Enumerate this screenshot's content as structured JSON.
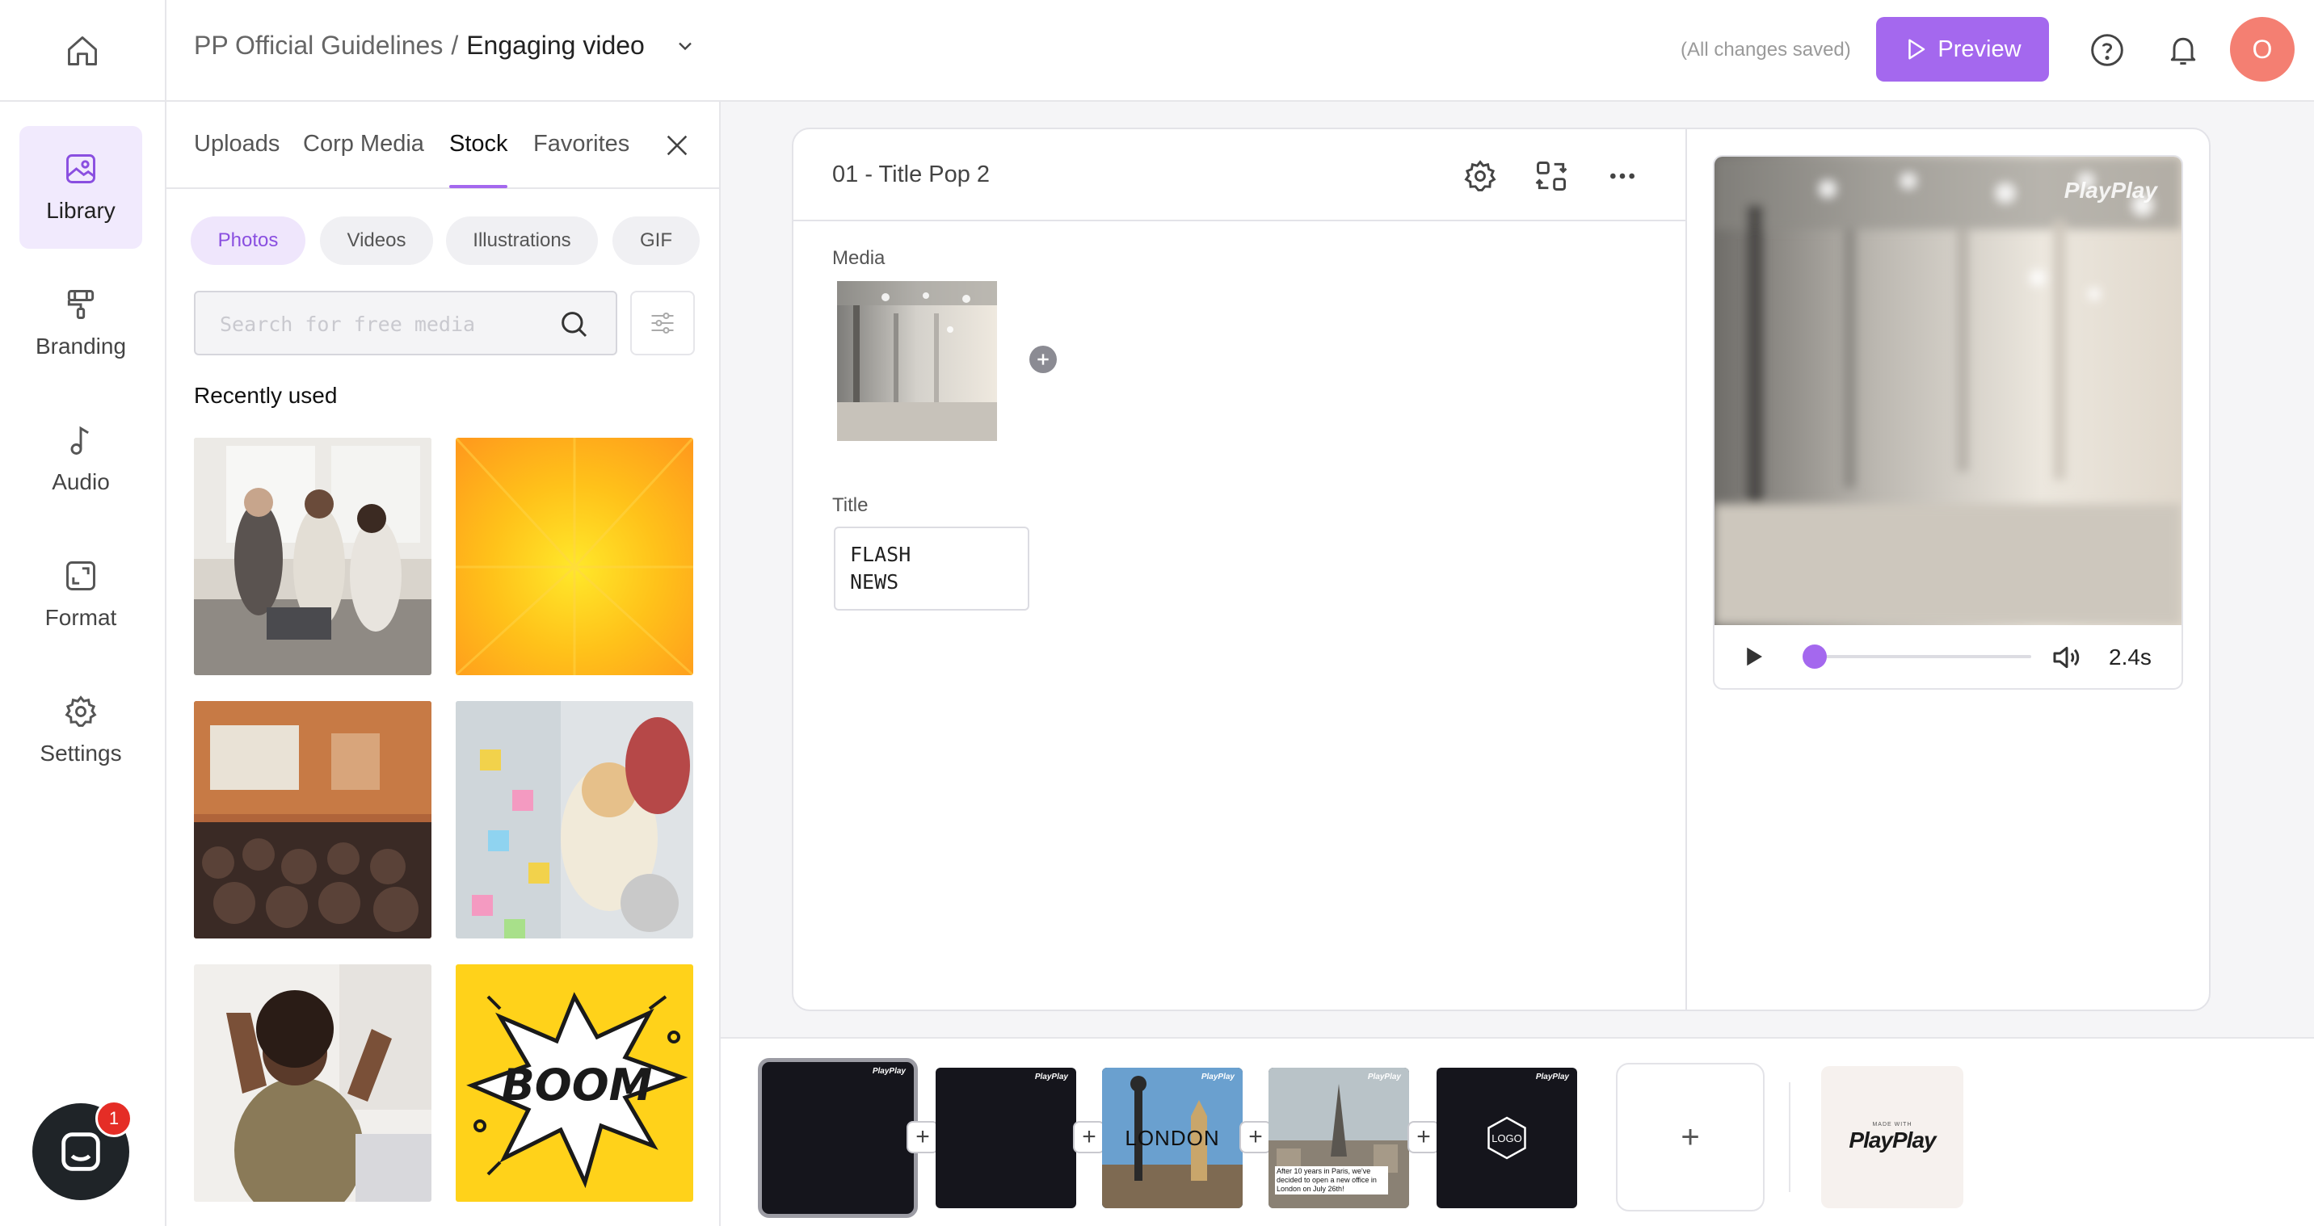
{
  "topbar": {
    "project": "PP Official Guidelines",
    "separator": "/",
    "video_title": "Engaging video",
    "saved_status": "(All changes saved)",
    "preview_label": "Preview",
    "avatar_initial": "O"
  },
  "nav": [
    {
      "label": "Library",
      "icon": "image-icon",
      "active": true
    },
    {
      "label": "Branding",
      "icon": "paint-roller-icon"
    },
    {
      "label": "Audio",
      "icon": "music-note-icon"
    },
    {
      "label": "Format",
      "icon": "resize-icon"
    },
    {
      "label": "Settings",
      "icon": "gear-icon"
    }
  ],
  "media_panel": {
    "tabs": [
      "Uploads",
      "Corp Media",
      "Stock",
      "Favorites"
    ],
    "active_tab": "Stock",
    "filters": [
      "Photos",
      "Videos",
      "Illustrations",
      "GIF"
    ],
    "active_filter": "Photos",
    "search_placeholder": "Search for free media",
    "section_title": "Recently used",
    "boom_text": "BOOM"
  },
  "editor": {
    "scene_title": "01 - Title Pop 2",
    "media_label": "Media",
    "title_label": "Title",
    "title_value": "FLASH\nNEWS"
  },
  "player": {
    "watermark": "PlayPlay",
    "time": "2.4s",
    "progress": 0.05
  },
  "timeline": {
    "scene_texts": [
      "",
      "",
      "LONDON",
      "After 10 years in Paris, we've decided to open a new office in London on July 26th!",
      "LOGO"
    ],
    "scene_logo": "PlayPlay",
    "add_symbol": "+",
    "outro_small": "MADE WITH",
    "outro_logo": "PlayPlay"
  },
  "chat": {
    "badge_count": "1"
  },
  "colors": {
    "accent": "#a468ee",
    "accent_light": "#f1eafd",
    "avatar": "#f47f72",
    "badge": "#e52d26"
  }
}
